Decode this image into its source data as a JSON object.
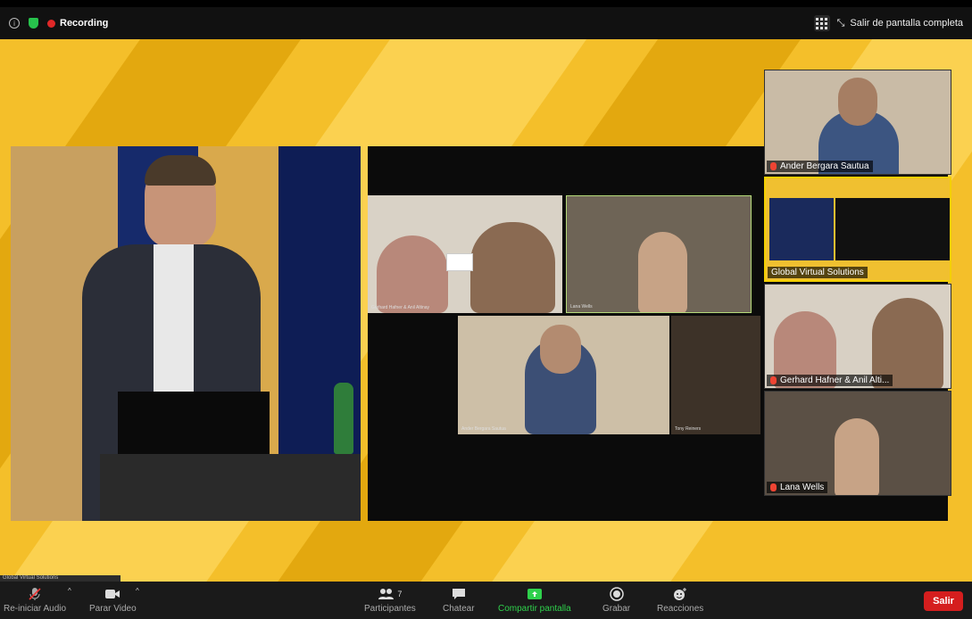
{
  "topbar": {
    "info_icon": "info-icon",
    "shield_icon": "shield-icon",
    "recording_label": "Recording",
    "exit_fullscreen_label": "Salir de pantalla completa"
  },
  "gallery": {
    "tiles": [
      {
        "name": "Gerhard Hafner & Anil Altinay"
      },
      {
        "name": "Lana Wells"
      },
      {
        "name": "Ander Bergara Sautua"
      },
      {
        "name": "Tony Reiners"
      }
    ]
  },
  "panel": {
    "tiles": [
      {
        "name": "Ander Bergara Sautua"
      },
      {
        "name": "Global Virtual Solutions"
      },
      {
        "name": "Gerhard Hafner & Anil Alti..."
      },
      {
        "name": "Lana Wells"
      }
    ]
  },
  "bottom_left_label": "Global Virtual Solutions",
  "toolbar": {
    "audio_label": "Re-iniciar Audio",
    "video_label": "Parar Video",
    "participants_label": "Participantes",
    "participants_count": "7",
    "chat_label": "Chatear",
    "share_label": "Compartir pantalla",
    "record_label": "Grabar",
    "reactions_label": "Reacciones",
    "leave_label": "Salir"
  },
  "colors": {
    "stage_yellow": "#f4bf2a",
    "active_border": "#f4d000",
    "leave_red": "#d51e1e",
    "share_green": "#2fd14c",
    "recording_red": "#e02828"
  }
}
